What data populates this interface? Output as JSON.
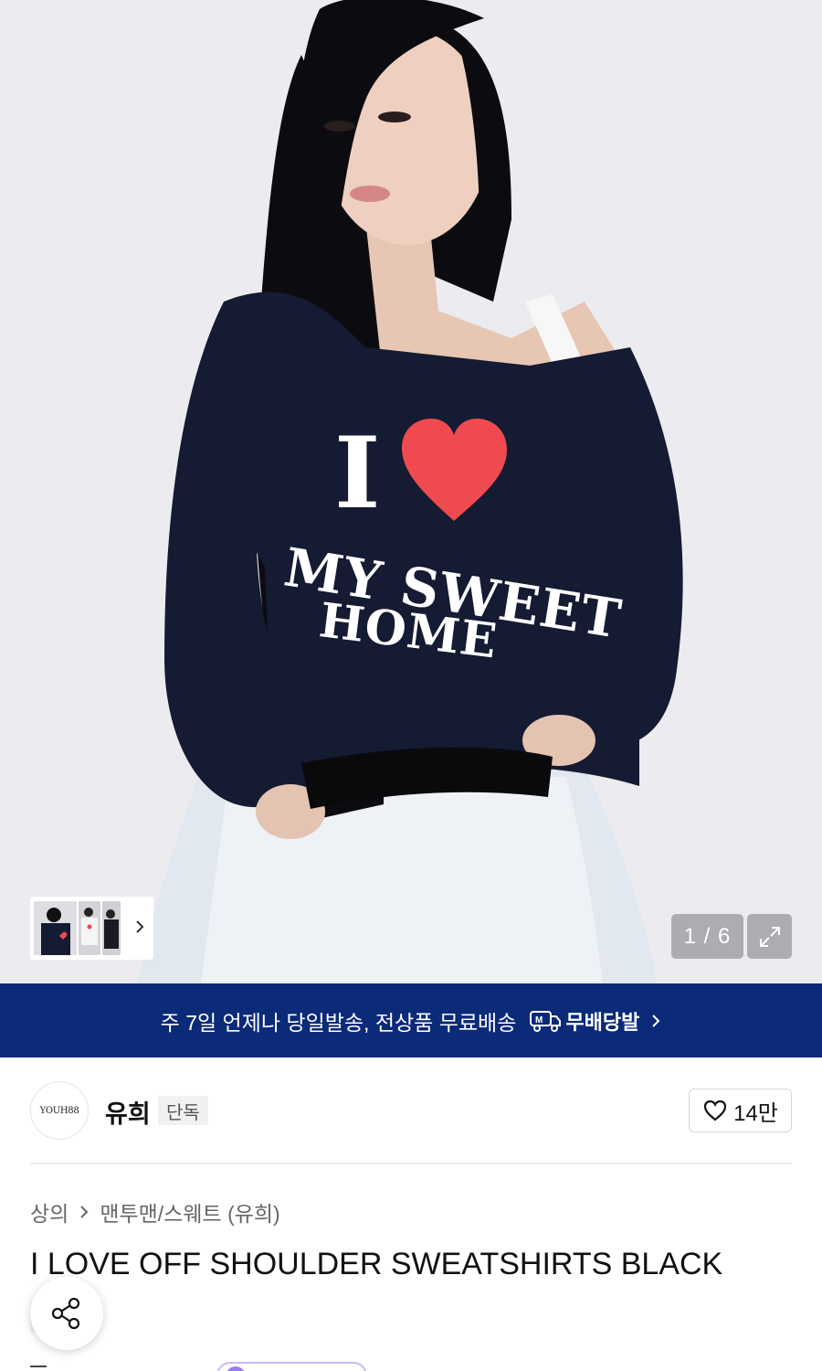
{
  "gallery": {
    "sweatshirt_print": {
      "big_letter": "I",
      "line1": "MY SWEET",
      "line2": "HOME"
    },
    "counter": "1 / 6",
    "heart_color": "#ef4a4f",
    "sweatshirt_color": "#141b32"
  },
  "banner": {
    "text": "주 7일 언제나 당일발송, 전상품 무료배송",
    "logo_label": "무배당발",
    "background": "#0b2a78"
  },
  "brand": {
    "logo_text": "YOUH88",
    "name": "유희",
    "badge": "단독",
    "likes": "14만"
  },
  "breadcrumb": {
    "items": [
      "상의",
      "맨투맨/스웨트 (유희)"
    ]
  },
  "product": {
    "title": "I LOVE OFF SHOULDER SWEATSHIRTS BLACK",
    "tag": "단독"
  }
}
